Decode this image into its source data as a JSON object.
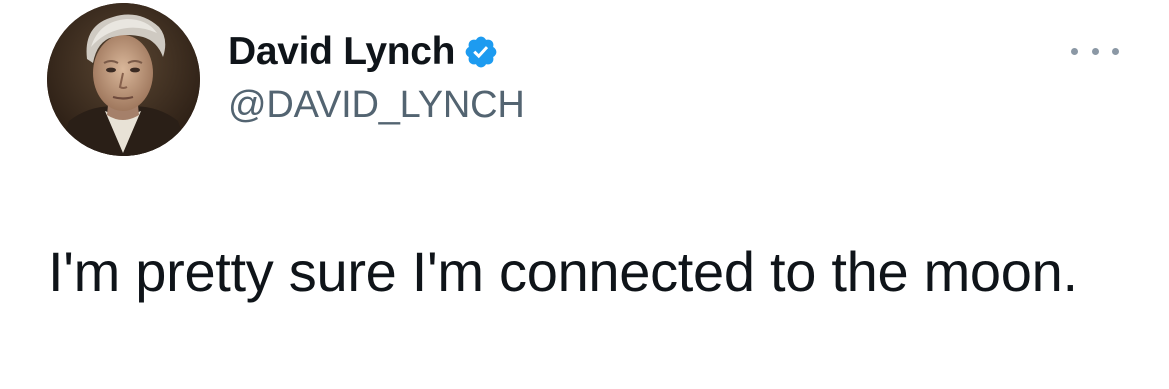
{
  "author": {
    "display_name": "David Lynch",
    "handle": "@DAVID_LYNCH",
    "verified": true,
    "avatar": "profile-photo"
  },
  "tweet": {
    "text": "I'm pretty sure I'm connected to the moon."
  },
  "icons": {
    "verified": "verified-badge-icon",
    "more": "more-options-icon"
  },
  "colors": {
    "verified_blue": "#1d9bf0",
    "text": "#0f1419",
    "secondary_text": "#536471",
    "more_dots": "#8b98a5",
    "background": "#ffffff"
  }
}
